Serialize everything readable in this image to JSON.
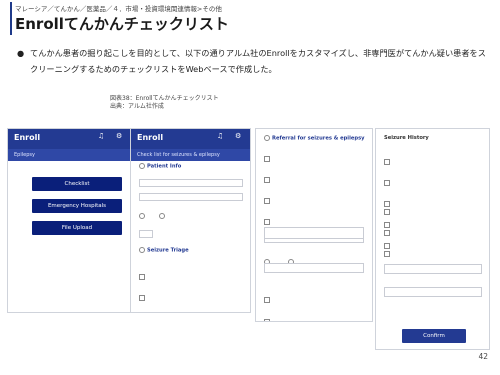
{
  "breadcrumb": "マレーシア／てんかん／医薬品／４．市場・投資環境関連情報>その他",
  "title": "Enrollてんかんチェックリスト",
  "bullet_text": "てんかん患者の掘り起こしを目的として、以下の通りアルム社のEnrollをカスタマイズし、非専門医がてんかん疑い患者をスクリーニングするためのチェックリストをWebベースで作成した。",
  "caption_line1": "図表38：Enrollてんかんチェックリスト",
  "caption_line2": "出典：アルム社作成",
  "page_number": "42",
  "phone1": {
    "brand": "Enroll",
    "sub": "Epilepsy",
    "buttons": [
      "Checklist",
      "Emergency Hospitals",
      "File Upload"
    ]
  },
  "phone2": {
    "brand": "Enroll",
    "sub": "Check list for seizures & epilepsy",
    "patient_info": "Patient Info",
    "seizure_triage": "Seizure Triage"
  },
  "phone3": {
    "referral": "Referral for seizures & epilepsy",
    "seizure_history": "Seizure History",
    "confirm": "Confirm"
  }
}
